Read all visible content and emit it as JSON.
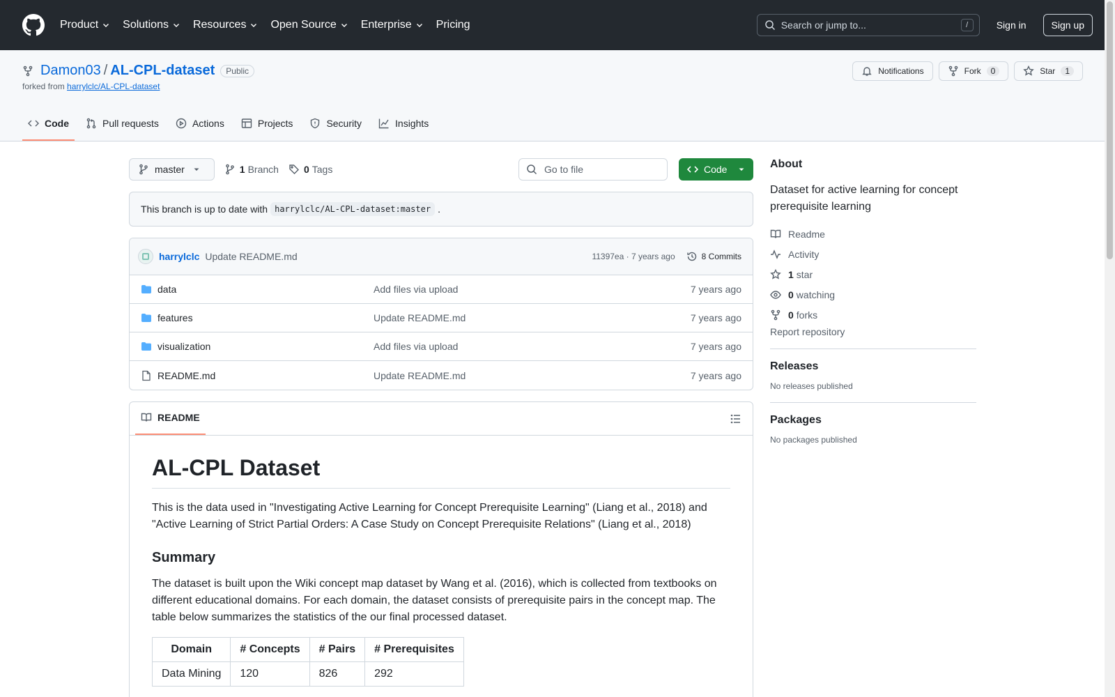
{
  "header": {
    "nav": [
      {
        "label": "Product",
        "dropdown": true
      },
      {
        "label": "Solutions",
        "dropdown": true
      },
      {
        "label": "Resources",
        "dropdown": true
      },
      {
        "label": "Open Source",
        "dropdown": true
      },
      {
        "label": "Enterprise",
        "dropdown": true
      },
      {
        "label": "Pricing",
        "dropdown": false
      }
    ],
    "search_placeholder": "Search or jump to...",
    "search_key": "/",
    "sign_in": "Sign in",
    "sign_up": "Sign up"
  },
  "repo": {
    "owner": "Damon03",
    "separator": "/",
    "name": "AL-CPL-dataset",
    "visibility": "Public",
    "forked_prefix": "forked from",
    "forked_from": "harrylclc/AL-CPL-dataset",
    "notifications": "Notifications",
    "fork_label": "Fork",
    "fork_count": "0",
    "star_label": "Star",
    "star_count": "1",
    "tabs": [
      {
        "label": "Code",
        "icon": "code-icon",
        "active": true
      },
      {
        "label": "Pull requests",
        "icon": "pull-request-icon",
        "active": false
      },
      {
        "label": "Actions",
        "icon": "play-icon",
        "active": false
      },
      {
        "label": "Projects",
        "icon": "table-icon",
        "active": false
      },
      {
        "label": "Security",
        "icon": "shield-icon",
        "active": false
      },
      {
        "label": "Insights",
        "icon": "graph-icon",
        "active": false
      }
    ]
  },
  "toolbar": {
    "branch": "master",
    "branch_count": "1",
    "branch_label": "Branch",
    "tag_count": "0",
    "tag_label": "Tags",
    "goto_placeholder": "Go to file",
    "code_button": "Code"
  },
  "uptodate": {
    "prefix": "This branch is up to date with",
    "ref": "harrylclc/AL-CPL-dataset:master",
    "suffix": "."
  },
  "commit": {
    "author": "harrylclc",
    "message": "Update README.md",
    "hash_time": "11397ea · 7 years ago",
    "commits": "8 Commits"
  },
  "files": [
    {
      "name": "data",
      "type": "folder",
      "message": "Add files via upload",
      "time": "7 years ago"
    },
    {
      "name": "features",
      "type": "folder",
      "message": "Update README.md",
      "time": "7 years ago"
    },
    {
      "name": "visualization",
      "type": "folder",
      "message": "Add files via upload",
      "time": "7 years ago"
    },
    {
      "name": "README.md",
      "type": "file",
      "message": "Update README.md",
      "time": "7 years ago"
    }
  ],
  "readme": {
    "tab": "README",
    "title": "AL-CPL Dataset",
    "intro": "This is the data used in \"Investigating Active Learning for Concept Prerequisite Learning\" (Liang et al., 2018) and \"Active Learning of Strict Partial Orders: A Case Study on Concept Prerequisite Relations\" (Liang et al., 2018)",
    "summary_heading": "Summary",
    "summary": "The dataset is built upon the Wiki concept map dataset by Wang et al. (2016), which is collected from textbooks on different educational domains. For each domain, the dataset consists of prerequisite pairs in the concept map. The table below summarizes the statistics of the our final processed dataset.",
    "table_headers": [
      "Domain",
      "# Concepts",
      "# Pairs",
      "# Prerequisites"
    ],
    "table_rows": [
      [
        "Data Mining",
        "120",
        "826",
        "292"
      ]
    ]
  },
  "sidebar": {
    "about_heading": "About",
    "description": "Dataset for active learning for concept prerequisite learning",
    "readme": "Readme",
    "activity": "Activity",
    "stars_count": "1",
    "stars_label": "star",
    "watching_count": "0",
    "watching_label": "watching",
    "forks_count": "0",
    "forks_label": "forks",
    "report": "Report repository",
    "releases_heading": "Releases",
    "releases_empty": "No releases published",
    "packages_heading": "Packages",
    "packages_empty": "No packages published"
  },
  "colors": {
    "header_bg": "#24292f",
    "link": "#0969da",
    "primary_button": "#1f883d",
    "active_tab_underline": "#fd8c73",
    "folder": "#54aeff"
  }
}
